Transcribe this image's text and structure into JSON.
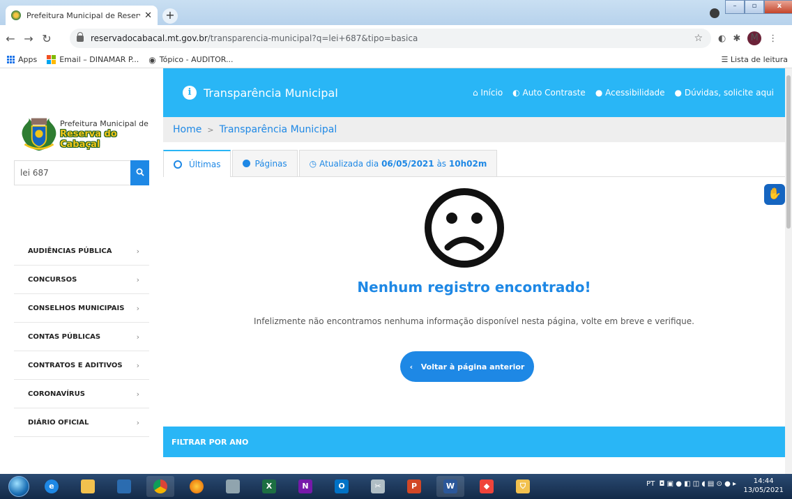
{
  "browser": {
    "tab_title": "Prefeitura Municipal de Reserva d",
    "tab_close": "✕",
    "new_tab": "+",
    "url_host": "reservadocabacal.mt.gov.br",
    "url_path": "/transparencia-municipal?q=lei+687&tipo=basica",
    "profile_initial": "M",
    "bookmarks": [
      {
        "label": "Apps"
      },
      {
        "label": "Email – DINAMAR P..."
      },
      {
        "label": "Tópico - AUDITOR..."
      }
    ],
    "reading_list": "Lista de leitura"
  },
  "sidebar": {
    "logo_line1": "Prefeitura Municipal de",
    "logo_line2": "Reserva do Cabaçal",
    "search_value": "lei 687",
    "menu": [
      {
        "label": "AUDIÊNCIAS PÚBLICA"
      },
      {
        "label": "CONCURSOS"
      },
      {
        "label": "CONSELHOS MUNICIPAIS"
      },
      {
        "label": "CONTAS PÚBLICAS"
      },
      {
        "label": "CONTRATOS E ADITIVOS"
      },
      {
        "label": "CORONAVÍRUS"
      },
      {
        "label": "DIÁRIO OFICIAL"
      }
    ],
    "chevron": "›"
  },
  "header": {
    "title": "Transparência Municipal",
    "nav": {
      "inicio": "Início",
      "contraste": "Auto Contraste",
      "acessibilidade": "Acessibilidade",
      "duvidas": "Dúvidas, solicite aqui"
    }
  },
  "breadcrumb": {
    "home": "Home",
    "separator": ">",
    "current": "Transparência Municipal"
  },
  "tabs": {
    "ultimas": "Últimas",
    "paginas": "Páginas",
    "atualizada_prefix": "Atualizada dia",
    "atualizada_date": "06/05/2021",
    "atualizada_mid": "às",
    "atualizada_time": "10h02m"
  },
  "empty": {
    "title": "Nenhum registro encontrado!",
    "body": "Infelizmente não encontramos nenhuma informação disponível nesta página, volte em breve e verifique.",
    "back_button": "Voltar à página anterior"
  },
  "filter": {
    "title": "FILTRAR POR ANO"
  },
  "taskbar": {
    "lang": "PT",
    "time": "14:44",
    "date": "13/05/2021"
  },
  "colors": {
    "primary": "#29b6f6",
    "accent": "#1e88e5"
  }
}
